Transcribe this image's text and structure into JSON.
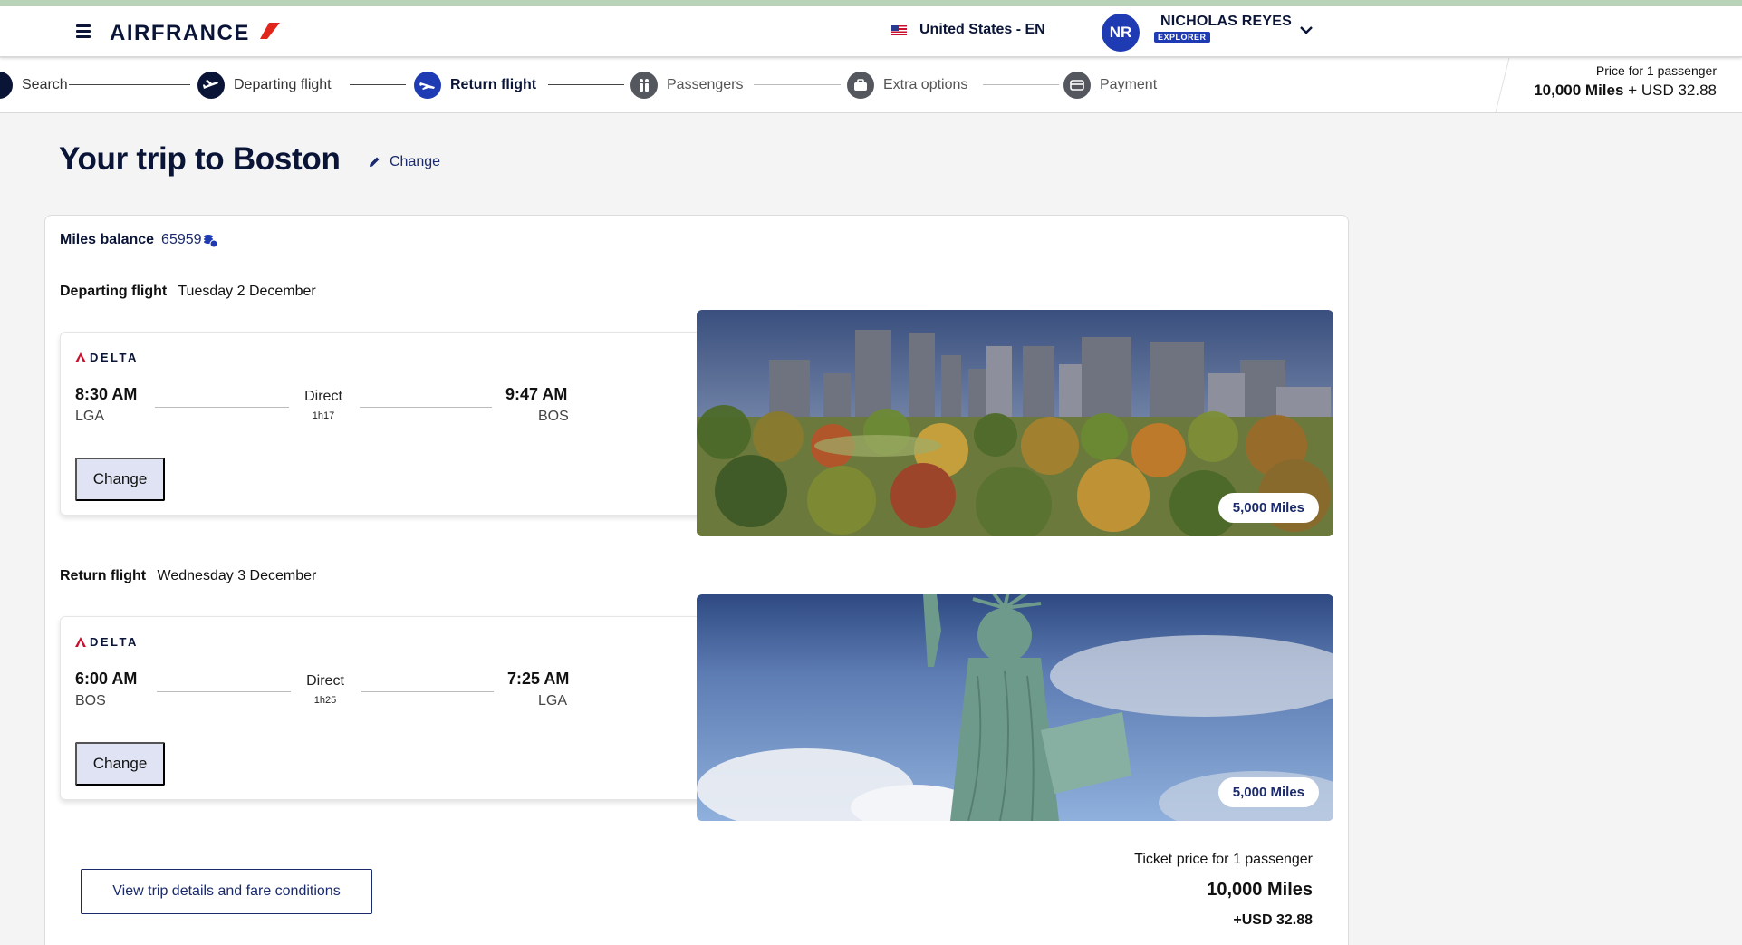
{
  "header": {
    "brand": "AIRFRANCE",
    "locale": "United States - EN",
    "user_initials": "NR",
    "user_name": "NICHOLAS REYES",
    "user_tier": "EXPLORER"
  },
  "steps": [
    {
      "label": "Search",
      "state": "done"
    },
    {
      "label": "Departing flight",
      "state": "done"
    },
    {
      "label": "Return flight",
      "state": "active"
    },
    {
      "label": "Passengers",
      "state": "upcoming"
    },
    {
      "label": "Extra options",
      "state": "upcoming"
    },
    {
      "label": "Payment",
      "state": "upcoming"
    }
  ],
  "price_summary": {
    "label": "Price for 1 passenger",
    "miles": "10,000 Miles",
    "plus": "+ USD 32.88"
  },
  "page_title": "Your trip to Boston",
  "change_label": "Change",
  "miles_balance": {
    "label": "Miles balance",
    "value": "65959"
  },
  "departing": {
    "label": "Departing flight",
    "date": "Tuesday 2 December",
    "airline": "DELTA",
    "dep_time": "8:30 AM",
    "dep_airport": "LGA",
    "type": "Direct",
    "duration": "1h17",
    "arr_time": "9:47 AM",
    "arr_airport": "BOS",
    "change": "Change",
    "miles": "5,000 Miles"
  },
  "return": {
    "label": "Return flight",
    "date": "Wednesday 3 December",
    "airline": "DELTA",
    "dep_time": "6:00 AM",
    "dep_airport": "BOS",
    "type": "Direct",
    "duration": "1h25",
    "arr_time": "7:25 AM",
    "arr_airport": "LGA",
    "change": "Change",
    "miles": "5,000 Miles"
  },
  "details_button": "View trip details and fare conditions",
  "ticket": {
    "label": "Ticket price for 1 passenger",
    "miles": "10,000 Miles",
    "usd": "+USD 32.88"
  },
  "colors": {
    "brand_navy": "#0a1437",
    "accent_blue": "#1f3bb3",
    "brand_red": "#e1251b"
  }
}
